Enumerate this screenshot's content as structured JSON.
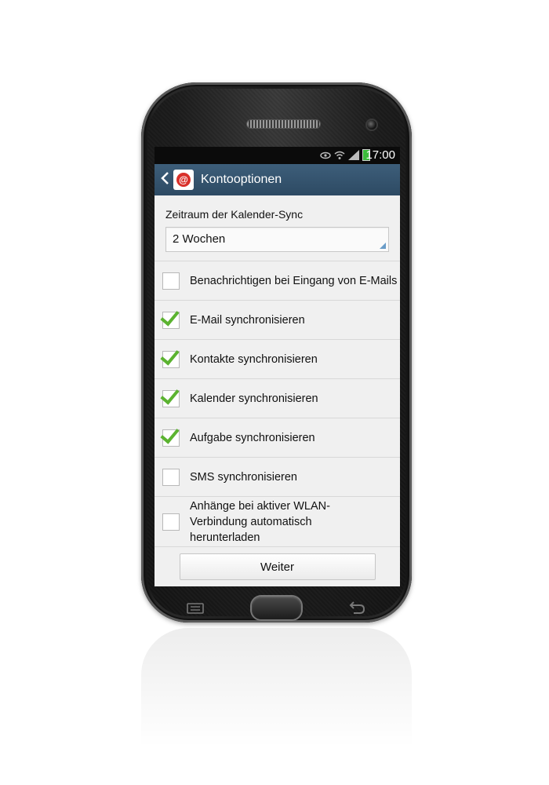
{
  "status_bar": {
    "time": "17:00"
  },
  "app_bar": {
    "title": "Kontooptionen"
  },
  "calendar_sync": {
    "label": "Zeitraum der Kalender-Sync",
    "selected": "2 Wochen"
  },
  "options": [
    {
      "label": "Benachrichtigen bei Eingang von E-Mails",
      "checked": false
    },
    {
      "label": "E-Mail synchronisieren",
      "checked": true
    },
    {
      "label": "Kontakte synchronisieren",
      "checked": true
    },
    {
      "label": "Kalender synchronisieren",
      "checked": true
    },
    {
      "label": "Aufgabe synchronisieren",
      "checked": true
    },
    {
      "label": "SMS synchronisieren",
      "checked": false
    },
    {
      "label": "Anhänge bei aktiver WLAN-Verbindung automatisch herunterladen",
      "checked": false
    }
  ],
  "footer": {
    "next_label": "Weiter"
  },
  "colors": {
    "app_bar": "#33536e",
    "check": "#5bb330",
    "status_bar": "#0b0b0b"
  }
}
